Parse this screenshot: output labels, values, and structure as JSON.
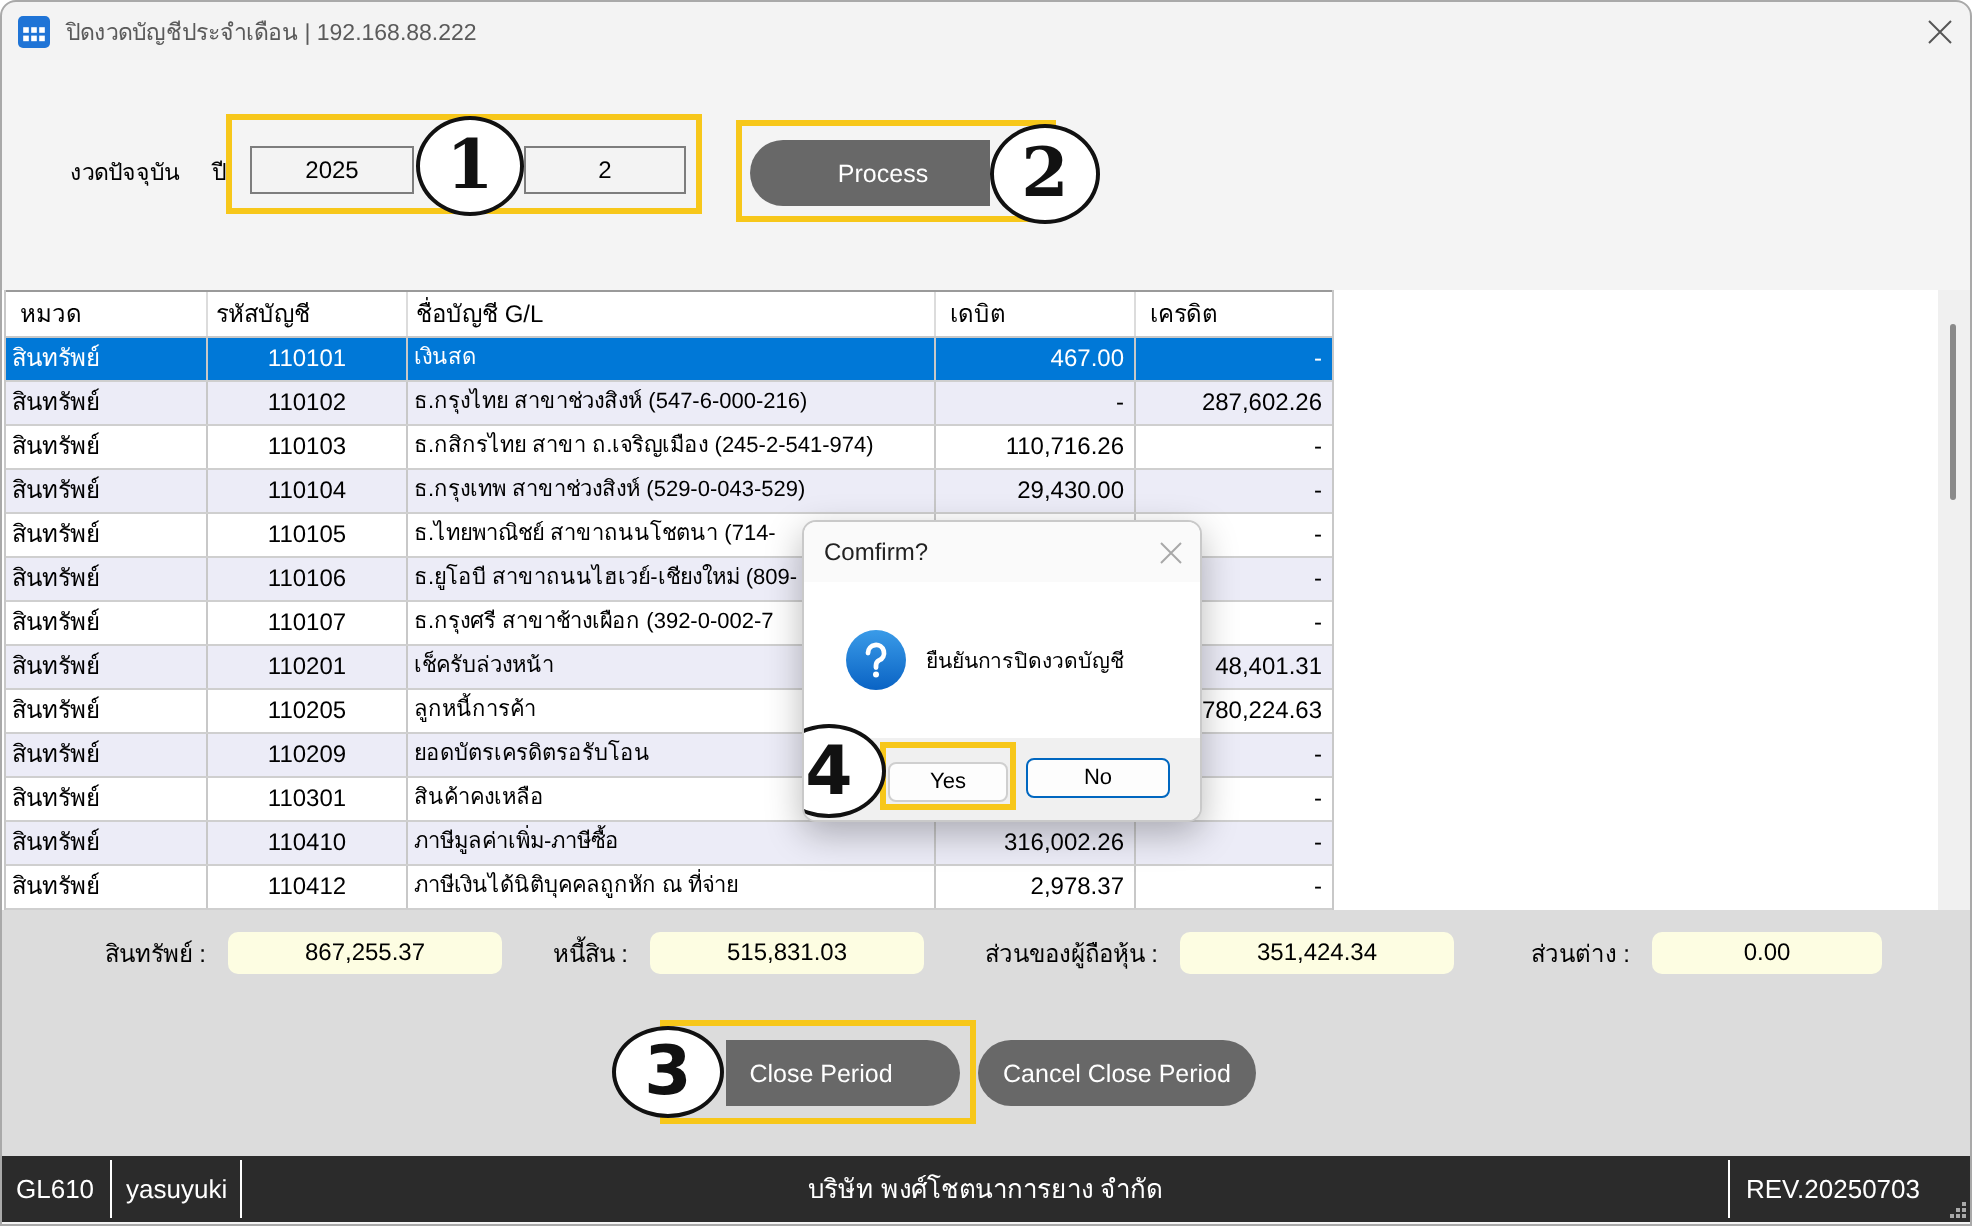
{
  "window": {
    "title": "ปิดงวดบัญชีประจำเดือน | 192.168.88.222"
  },
  "period": {
    "label": "งวดปัจจุบัน",
    "year_label": "ปี",
    "year": "2025",
    "month": "2"
  },
  "process_button": "Process",
  "table": {
    "columns": [
      "หมวด",
      "รหัสบัญชี",
      "ชื่อบัญชี G/L",
      "เดบิต",
      "เครดิต"
    ],
    "rows": [
      {
        "category": "สินทรัพย์",
        "code": "110101",
        "name": "เงินสด",
        "debit": "467.00",
        "credit": "-",
        "selected": true
      },
      {
        "category": "สินทรัพย์",
        "code": "110102",
        "name": "ธ.กรุงไทย สาขาช่วงสิงห์ (547-6-000-216)",
        "debit": "-",
        "credit": "287,602.26",
        "selected": false
      },
      {
        "category": "สินทรัพย์",
        "code": "110103",
        "name": "ธ.กสิกรไทย สาขา ถ.เจริญเมือง (245-2-541-974)",
        "debit": "110,716.26",
        "credit": "-",
        "selected": false
      },
      {
        "category": "สินทรัพย์",
        "code": "110104",
        "name": "ธ.กรุงเทพ สาขาช่วงสิงห์ (529-0-043-529)",
        "debit": "29,430.00",
        "credit": "-",
        "selected": false
      },
      {
        "category": "สินทรัพย์",
        "code": "110105",
        "name": "ธ.ไทยพาณิชย์ สาขาถนนโชตนา (714-",
        "credit": "-",
        "selected": false
      },
      {
        "category": "สินทรัพย์",
        "code": "110106",
        "name": "ธ.ยูโอบี สาขาถนนไฮเวย์-เชียงใหม่ (809-",
        "credit": "-",
        "selected": false
      },
      {
        "category": "สินทรัพย์",
        "code": "110107",
        "name": "ธ.กรุงศรี สาขาช้างเผือก (392-0-002-7",
        "credit": "-",
        "selected": false
      },
      {
        "category": "สินทรัพย์",
        "code": "110201",
        "name": "เช็ครับล่วงหน้า",
        "credit": "48,401.31",
        "selected": false
      },
      {
        "category": "สินทรัพย์",
        "code": "110205",
        "name": "ลูกหนี้การค้า",
        "credit": "780,224.63",
        "selected": false
      },
      {
        "category": "สินทรัพย์",
        "code": "110209",
        "name": "ยอดบัตรเครดิตรอรับโอน",
        "credit": "-",
        "selected": false
      },
      {
        "category": "สินทรัพย์",
        "code": "110301",
        "name": "สินค้าคงเหลือ",
        "credit": "-",
        "selected": false
      },
      {
        "category": "สินทรัพย์",
        "code": "110410",
        "name": "ภาษีมูลค่าเพิ่ม-ภาษีซื้อ",
        "debit": "316,002.26",
        "credit": "-",
        "selected": false
      },
      {
        "category": "สินทรัพย์",
        "code": "110412",
        "name": "ภาษีเงินได้นิติบุคคลถูกหัก ณ ที่จ่าย",
        "debit": "2,978.37",
        "credit": "-",
        "selected": false
      }
    ]
  },
  "totals": [
    {
      "label": "สินทรัพย์ :",
      "value": "867,255.37"
    },
    {
      "label": "หนี้สิน :",
      "value": "515,831.03"
    },
    {
      "label": "ส่วนของผู้ถือหุ้น :",
      "value": "351,424.34"
    },
    {
      "label": "ส่วนต่าง :",
      "value": "0.00"
    }
  ],
  "buttons": [
    "Close Period",
    "Cancel Close Period"
  ],
  "status_bar": {
    "program": "GL610",
    "user": "yasuyuki",
    "company": "บริษัท พงศ์โชตนาการยาง จำกัด",
    "revision": "REV.20250703"
  },
  "dialog": {
    "title": "Comfirm?",
    "message": "ยืนยันการปิดงวดบัญชี",
    "buttons": [
      {
        "label": "Yes",
        "default": false
      },
      {
        "label": "No",
        "default": true
      }
    ]
  },
  "callouts": [
    "1",
    "2",
    "3",
    "4"
  ]
}
